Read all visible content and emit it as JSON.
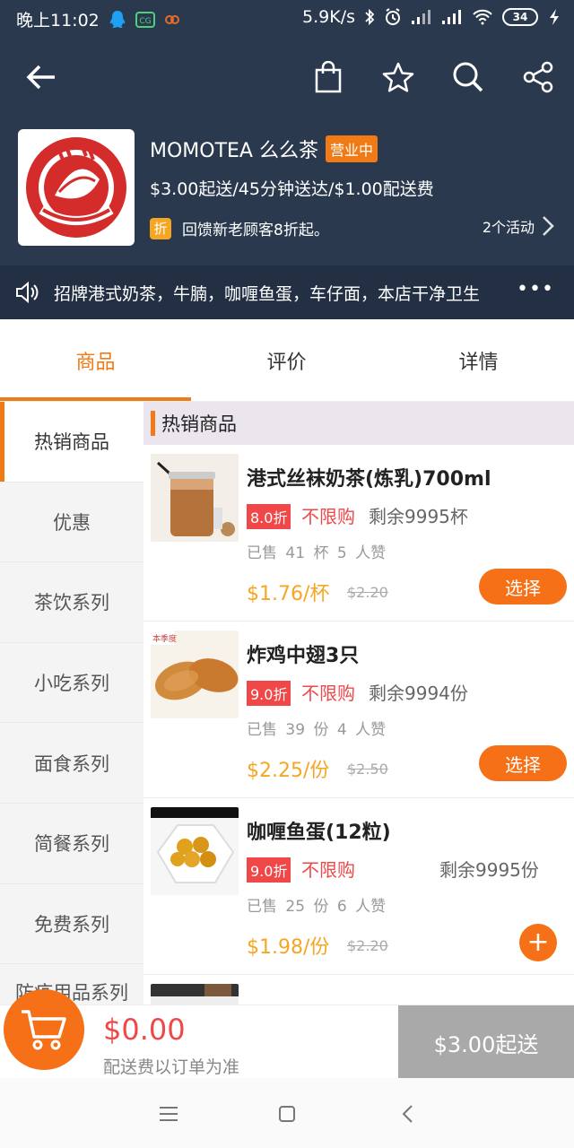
{
  "status_bar": {
    "time": "晚上11:02",
    "network_speed": "5.9K/s",
    "battery": "34"
  },
  "shop": {
    "name": "MOMOTEA 么么茶",
    "status_badge": "营业中",
    "delivery_info": "$3.00起送/45分钟送达/$1.00配送费",
    "promo_icon": "折",
    "promo_text": "回馈新老顾客8折起。",
    "activities_label": "2个活动"
  },
  "notice": {
    "text": "招牌港式奶茶，牛腩，咖喱鱼蛋，车仔面，本店干净卫生",
    "more": "•••"
  },
  "tabs": [
    {
      "label": "商品"
    },
    {
      "label": "评价"
    },
    {
      "label": "详情"
    }
  ],
  "categories": [
    {
      "label": "热销商品"
    },
    {
      "label": "优惠"
    },
    {
      "label": "茶饮系列"
    },
    {
      "label": "小吃系列"
    },
    {
      "label": "面食系列"
    },
    {
      "label": "简餐系列"
    },
    {
      "label": "免费系列"
    },
    {
      "label": "防疫用品系列"
    }
  ],
  "section": {
    "title": "热销商品"
  },
  "products": [
    {
      "name": "港式丝袜奶茶(炼乳)700ml",
      "discount": "8.0折",
      "limit": "不限购",
      "stock": "剩余9995杯",
      "sold": "已售 41 杯   5 人赞",
      "price": "$1.76/杯",
      "old_price": "$2.20",
      "action": "选择"
    },
    {
      "name": "炸鸡中翅3只",
      "discount": "9.0折",
      "limit": "不限购",
      "stock": "剩余9994份",
      "sold": "已售 39 份   4 人赞",
      "price": "$2.25/份",
      "old_price": "$2.50",
      "action": "选择"
    },
    {
      "name": "咖喱鱼蛋(12粒)",
      "discount": "9.0折",
      "limit": "不限购",
      "stock": "剩余9995份",
      "sold": "已售 25 份   6 人赞",
      "price": "$1.98/份",
      "old_price": "$2.20",
      "action": "+"
    }
  ],
  "cart": {
    "total": "$0.00",
    "note": "配送费以订单为准",
    "min_order": "$3.00起送"
  },
  "colors": {
    "header_bg": "#2b394f",
    "accent": "#f07b16",
    "price": "#f5a623",
    "discount_red": "#f04848"
  }
}
